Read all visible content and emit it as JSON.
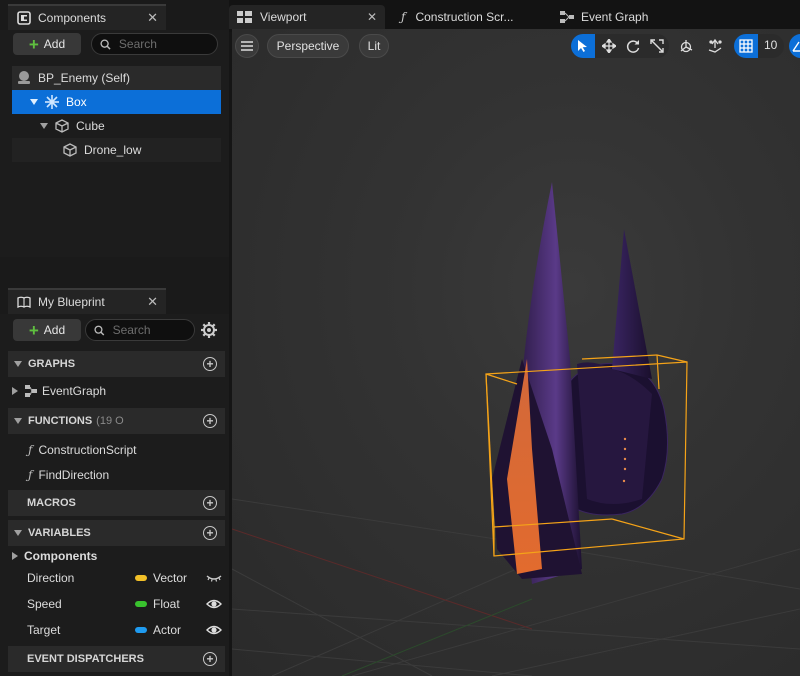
{
  "components_panel": {
    "tab_label": "Components",
    "add_label": "Add",
    "search_placeholder": "Search",
    "tree": [
      {
        "label": "BP_Enemy (Self)"
      },
      {
        "label": "Box"
      },
      {
        "label": "Cube"
      },
      {
        "label": "Drone_low"
      }
    ]
  },
  "blueprint_panel": {
    "tab_label": "My Blueprint",
    "add_label": "Add",
    "search_placeholder": "Search",
    "sections": {
      "graphs": "GRAPHS",
      "functions": "FUNCTIONS",
      "functions_count": "(19 O",
      "macros": "MACROS",
      "variables": "VARIABLES",
      "event_dispatchers": "EVENT DISPATCHERS"
    },
    "graph_items": [
      "EventGraph"
    ],
    "function_items": [
      "ConstructionScript",
      "FindDirection"
    ],
    "variable_category": "Components",
    "variables": [
      {
        "name": "Direction",
        "type": "Vector",
        "color": "#f2c028"
      },
      {
        "name": "Speed",
        "type": "Float",
        "color": "#39c22e"
      },
      {
        "name": "Target",
        "type": "Actor",
        "color": "#1f9bf0"
      }
    ]
  },
  "editor_tabs": [
    {
      "label": "Viewport"
    },
    {
      "label": "Construction Scr..."
    },
    {
      "label": "Event Graph"
    }
  ],
  "viewport": {
    "perspective_label": "Perspective",
    "lit_label": "Lit",
    "grid_snap_value": "10",
    "accent_color": "#0c6fd8",
    "selection_color": "#f5a318"
  }
}
